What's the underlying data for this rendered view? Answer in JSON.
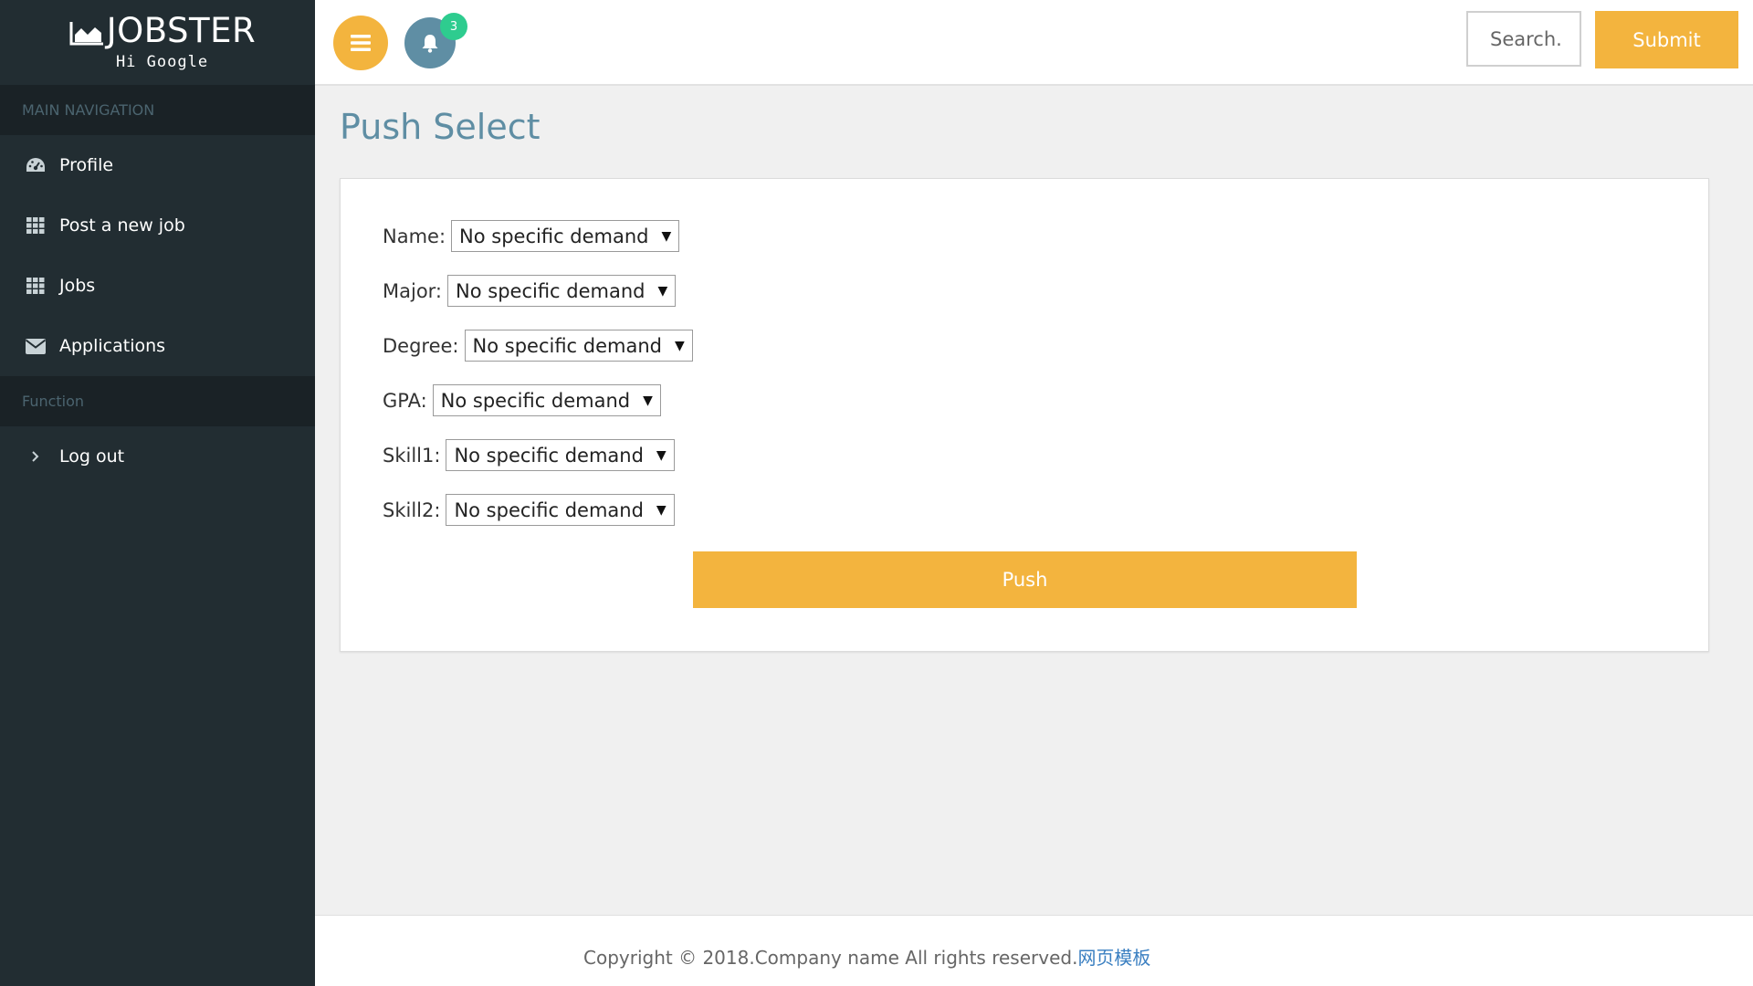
{
  "brand": {
    "name": "JOBSTER",
    "greeting": "Hi Google"
  },
  "sidebar": {
    "section_main": "MAIN NAVIGATION",
    "items": [
      {
        "label": "Profile",
        "icon": "dashboard-icon"
      },
      {
        "label": "Post a new job",
        "icon": "grid-icon"
      },
      {
        "label": "Jobs",
        "icon": "grid-icon"
      },
      {
        "label": "Applications",
        "icon": "envelope-icon"
      }
    ],
    "section_function": "Function",
    "logout": {
      "label": "Log out",
      "icon": "chevron-right-icon"
    }
  },
  "topbar": {
    "notification_count": "3",
    "search_placeholder": "Search.",
    "submit_label": "Submit"
  },
  "page": {
    "title": "Push Select",
    "fields": [
      {
        "label": "Name:",
        "value": "No specific demand"
      },
      {
        "label": "Major:",
        "value": "No specific demand"
      },
      {
        "label": "Degree:",
        "value": "No specific demand"
      },
      {
        "label": "GPA:",
        "value": "No specific demand"
      },
      {
        "label": "Skill1:",
        "value": "No specific demand"
      },
      {
        "label": "Skill2:",
        "value": "No specific demand"
      }
    ],
    "push_label": "Push"
  },
  "footer": {
    "copyright": "Copyright © 2018.Company name All rights reserved.",
    "link": "网页模板"
  },
  "colors": {
    "sidebar": "#222d32",
    "accent": "#f3b43e",
    "title": "#5f8ea4",
    "badge": "#2ecc8f"
  }
}
